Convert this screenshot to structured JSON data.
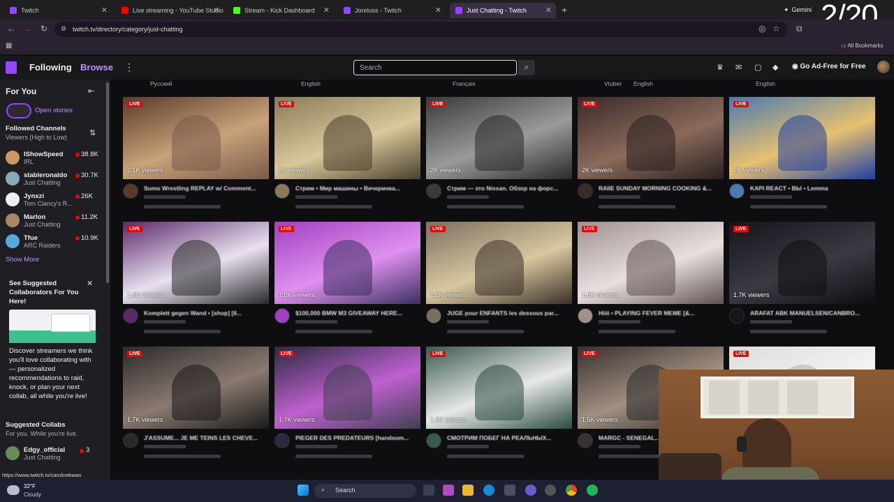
{
  "browser": {
    "tabs": [
      {
        "title": "Twitch",
        "color": "#9146ff"
      },
      {
        "title": "Live streaming - YouTube Studio",
        "color": "#ff0000"
      },
      {
        "title": "Stream - Kick Dashboard",
        "color": "#53fc18"
      },
      {
        "title": "Joreluss - Twitch",
        "color": "#9146ff"
      },
      {
        "title": "Just Chatting - Twitch",
        "color": "#9146ff"
      }
    ],
    "gemini_label": "Gemini",
    "url": "twitch.tv/directory/category/just-chatting",
    "all_bookmarks": "All Bookmarks",
    "status_url": "https://www.twitch.tv/carolinekwan"
  },
  "overlay_counter": "2/20",
  "topnav": {
    "following": "Following",
    "browse": "Browse",
    "search_placeholder": "Search",
    "ad_free": "Go Ad-Free for Free"
  },
  "sidebar": {
    "for_you": "For You",
    "open_stories": "Open stories",
    "followed_title": "Followed Channels",
    "followed_sort": "Viewers (High to Low)",
    "channels": [
      {
        "name": "IShowSpeed",
        "game": "IRL",
        "viewers": "38.8K",
        "color": "#c96"
      },
      {
        "name": "stableronaldo",
        "game": "Just Chatting",
        "viewers": "30.7K",
        "color": "#8ab"
      },
      {
        "name": "Jynxzi",
        "game": "Tom Clancy's R...",
        "viewers": "26K",
        "color": "#eee"
      },
      {
        "name": "Marlon",
        "game": "Just Chatting",
        "viewers": "11.2K",
        "color": "#a86"
      },
      {
        "name": "Tfue",
        "game": "ARC Raiders",
        "viewers": "10.9K",
        "color": "#5ad"
      }
    ],
    "show_more": "Show More",
    "suggest_title": "See Suggested Collaborators For You Here!",
    "suggest_body": "Discover streamers we think you'll love collaborating with — personalized recommendations to raid, knock, or plan your next collab, all while you're live!",
    "collabs_title": "Suggested Collabs",
    "collabs_sub": "For you. While you're live.",
    "collab": {
      "name": "Edgy_official",
      "game": "Just Chatting",
      "viewers": "3"
    }
  },
  "languages": [
    "Русский",
    "English",
    "Français",
    "Vtuber",
    "English",
    "English"
  ],
  "streams": [
    {
      "viewers": "2.1K viewers",
      "title": "Sumo Wrestling REPLAY w/ Comment...",
      "colors": [
        "#5a3a2a",
        "#c9a27a",
        "#7a5a4a"
      ]
    },
    {
      "viewers": "2K viewers",
      "title": "Стрим • Мир машины • Вечеринка...",
      "colors": [
        "#8a7a5a",
        "#d8c89a",
        "#4a4030"
      ]
    },
    {
      "viewers": "2K viewers",
      "title": "Стрим — это Nissan. Обзор на форс...",
      "colors": [
        "#3a3a3a",
        "#9a9a9a",
        "#2a2a2a"
      ]
    },
    {
      "viewers": "2K viewers",
      "title": "RAIIE SUNDAY MORNING COOKING &...",
      "colors": [
        "#3a2a2a",
        "#8a6a5a",
        "#2a2020"
      ]
    },
    {
      "viewers": "2K viewers",
      "title": "KAPI REACT • ВЫ • Lemma",
      "colors": [
        "#4a7ab0",
        "#e8c070",
        "#2040a0"
      ]
    },
    {
      "viewers": "1.9K viewers",
      "title": "Komplett gegen Wand • [shop] [6...",
      "colors": [
        "#5a2a6a",
        "#e8e0f0",
        "#2a2a2a"
      ]
    },
    {
      "viewers": "1.8K viewers",
      "title": "$100,000 BMW M3 GIVEAWAY HERE...",
      "colors": [
        "#a040c0",
        "#e090f0",
        "#3a3060"
      ]
    },
    {
      "viewers": "1.8K viewers",
      "title": "JUGE pour ENFANTS les dessous par...",
      "colors": [
        "#7a7060",
        "#d8c8a0",
        "#3a3028"
      ]
    },
    {
      "viewers": "1.8K viewers",
      "title": "Hiiii • PLAYING FEVER MEME [&...",
      "colors": [
        "#a09090",
        "#e8e0e0",
        "#605050"
      ]
    },
    {
      "viewers": "1.7K viewers",
      "title": "ARAFAT ABK MANUELSEN/CANBRO...",
      "colors": [
        "#15151a",
        "#3a3a44",
        "#0e0e10"
      ]
    },
    {
      "viewers": "1.7K viewers",
      "title": "J'ASSUME... JE ME TEINS LES CHEVE...",
      "colors": [
        "#2a2a2a",
        "#8a7a70",
        "#1a1a1a"
      ]
    },
    {
      "viewers": "1.7K viewers",
      "title": "PIEGER DES PREDATEURS [handsom...",
      "colors": [
        "#2a2a40",
        "#c060d0",
        "#404050"
      ]
    },
    {
      "viewers": "1.6K viewers",
      "title": "СМОТРИМ ПОБЕГ НА РЕАЛЬНЫХ...",
      "colors": [
        "#3a5a50",
        "#e8e8e8",
        "#2a4a40"
      ]
    },
    {
      "viewers": "1.5K viewers",
      "title": "MARGC - SENEGAL...",
      "colors": [
        "#3a3030",
        "#a09080",
        "#2a2a2a"
      ]
    },
    {
      "viewers": "",
      "title": "",
      "colors": [
        "#dcdcdc",
        "#f4f4f4",
        "#b0b0b0"
      ]
    }
  ],
  "live_label": "LIVE",
  "taskbar": {
    "temp": "32°F",
    "condition": "Cloudy",
    "search": "Search"
  }
}
